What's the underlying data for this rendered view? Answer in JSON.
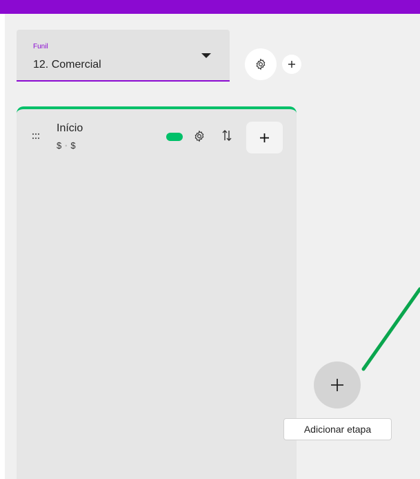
{
  "colors": {
    "accent": "#8b0ad1",
    "success": "#00c069",
    "background": "#f0f0f0"
  },
  "funnel": {
    "label": "Funil",
    "value": "12. Comercial"
  },
  "toolbar": {
    "settings_icon": "gear-icon",
    "add_icon": "plus-icon"
  },
  "column": {
    "title": "Início",
    "money_left": "$",
    "money_separator": "•",
    "money_right": "$",
    "toggle_on": true
  },
  "add_stage": {
    "tooltip": "Adicionar etapa"
  }
}
